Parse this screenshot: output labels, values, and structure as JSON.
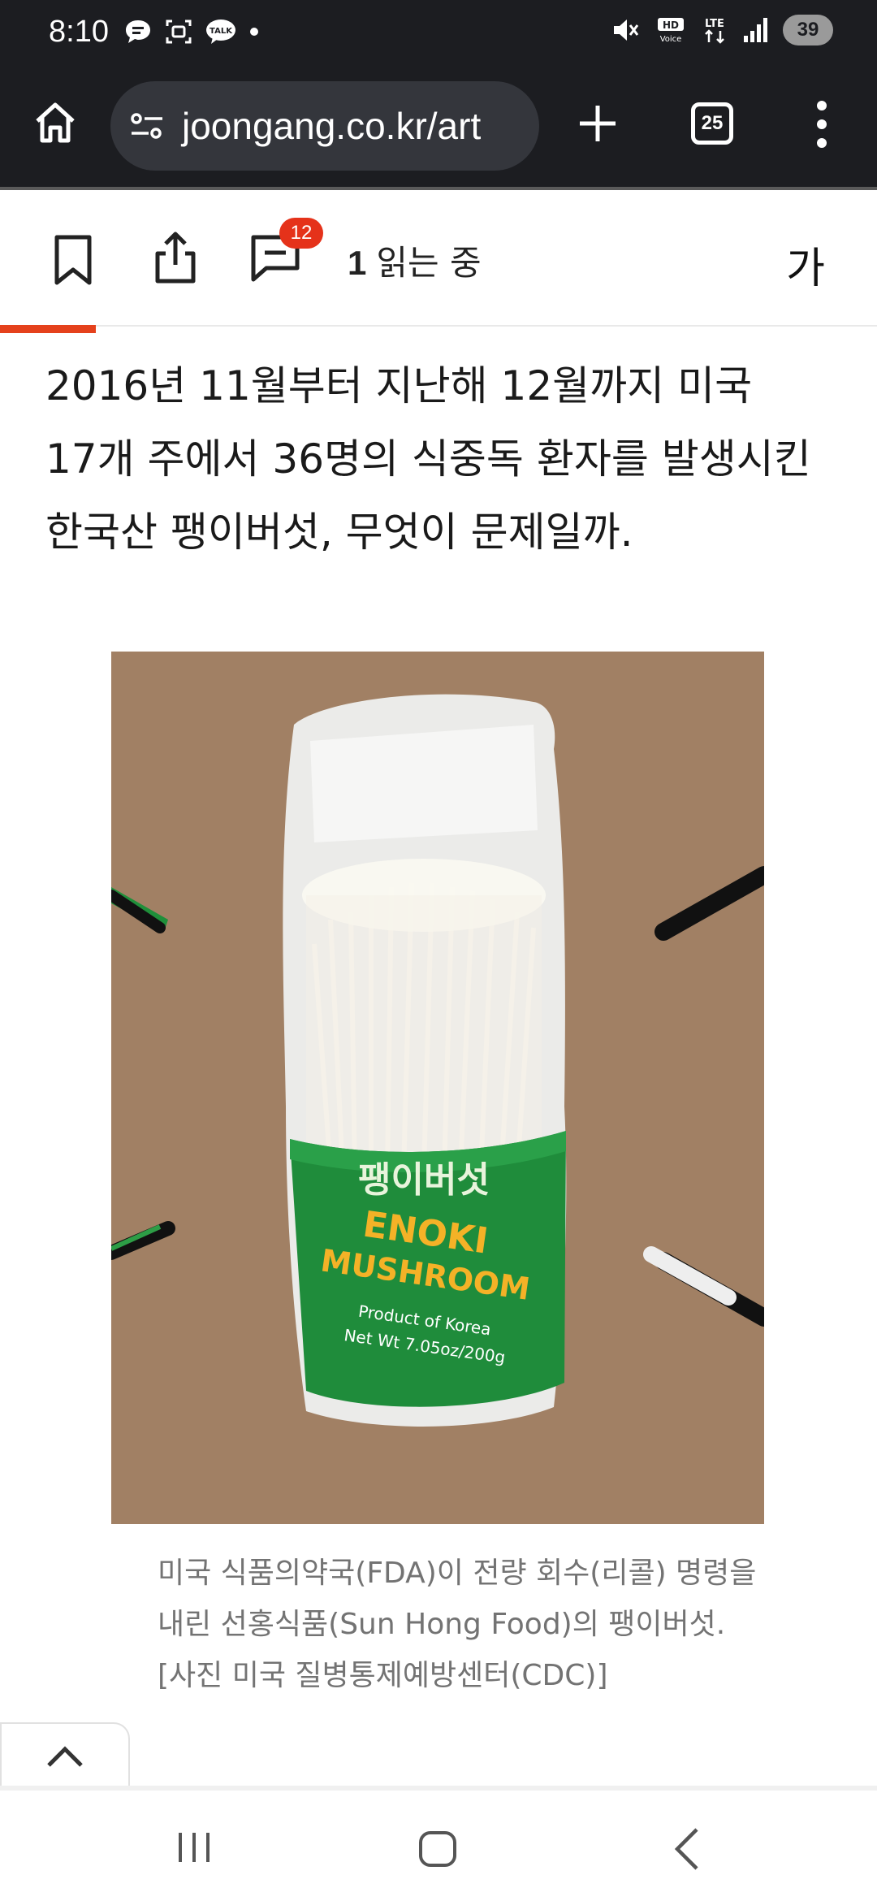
{
  "status_bar": {
    "time": "8:10",
    "battery": "39",
    "hd_label": "HD",
    "voice_label": "Voice",
    "lte_label": "LTE",
    "talk_label": "TALK"
  },
  "browser": {
    "url": "joongang.co.kr/art",
    "tab_count": "25"
  },
  "article_bar": {
    "comment_count": "12",
    "reading_number": "1",
    "reading_label": "읽는 중",
    "font_size_label": "가"
  },
  "article": {
    "paragraph": "2016년 11월부터 지난해 12월까지 미국 17개 주에서 36명의 식중독 환자를 발생시킨 한국산 팽이버섯, 무엇이 문제일까.",
    "image": {
      "package_korean": "팽이버섯",
      "package_line1": "ENOKI",
      "package_line2": "MUSHROOM",
      "package_line3": "Product of Korea",
      "package_line4": "Net Wt 7.05oz/200g"
    },
    "caption": "미국 식품의약국(FDA)이 전량 회수(리콜) 명령을 내린 선홍식품(Sun Hong Food)의 팽이버섯. [사진 미국 질병통제예방센터(CDC)]"
  },
  "colors": {
    "chrome_bg": "#1c1d21",
    "url_pill": "#34363c",
    "accent_red": "#e5411c",
    "badge_red": "#e5321a",
    "caption_gray": "#737373"
  }
}
